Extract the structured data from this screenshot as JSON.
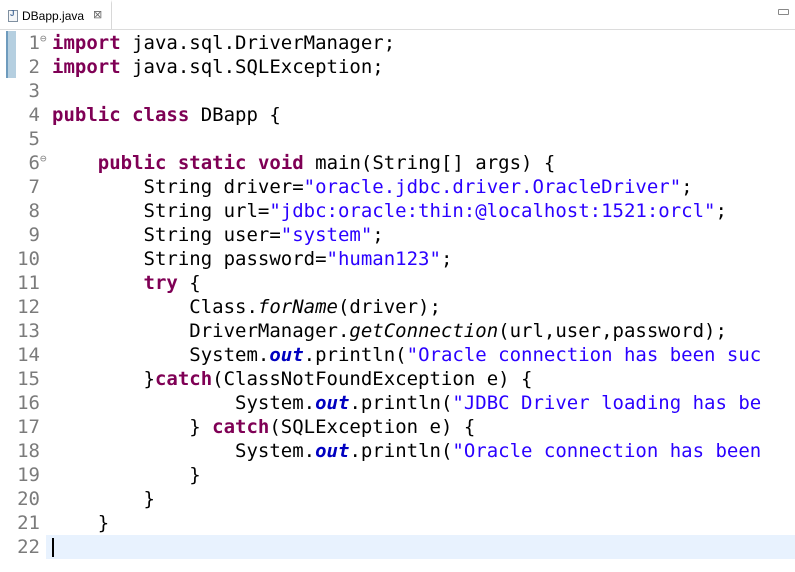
{
  "tab": {
    "title": "DBapp.java",
    "close_glyph": "⊠"
  },
  "editor": {
    "lines": [
      {
        "n": "1",
        "fold": "⊖",
        "tokens": [
          {
            "t": "import",
            "c": "kw"
          },
          {
            "t": " java.sql.DriverManager;",
            "c": ""
          }
        ]
      },
      {
        "n": "2",
        "tokens": [
          {
            "t": "import",
            "c": "kw"
          },
          {
            "t": " java.sql.SQLException;",
            "c": ""
          }
        ]
      },
      {
        "n": "3",
        "tokens": []
      },
      {
        "n": "4",
        "tokens": [
          {
            "t": "public",
            "c": "kw"
          },
          {
            "t": " ",
            "c": ""
          },
          {
            "t": "class",
            "c": "kw"
          },
          {
            "t": " DBapp {",
            "c": ""
          }
        ]
      },
      {
        "n": "5",
        "tokens": []
      },
      {
        "n": "6",
        "fold": "⊖",
        "tokens": [
          {
            "t": "    ",
            "c": ""
          },
          {
            "t": "public",
            "c": "kw"
          },
          {
            "t": " ",
            "c": ""
          },
          {
            "t": "static",
            "c": "kw"
          },
          {
            "t": " ",
            "c": ""
          },
          {
            "t": "void",
            "c": "kw"
          },
          {
            "t": " main(String[] args) {",
            "c": ""
          }
        ]
      },
      {
        "n": "7",
        "tokens": [
          {
            "t": "        String driver=",
            "c": ""
          },
          {
            "t": "\"oracle.jdbc.driver.OracleDriver\"",
            "c": "str"
          },
          {
            "t": ";",
            "c": ""
          }
        ]
      },
      {
        "n": "8",
        "tokens": [
          {
            "t": "        String url=",
            "c": ""
          },
          {
            "t": "\"jdbc:oracle:thin:@localhost:1521:orcl\"",
            "c": "str"
          },
          {
            "t": ";",
            "c": ""
          }
        ]
      },
      {
        "n": "9",
        "tokens": [
          {
            "t": "        String user=",
            "c": ""
          },
          {
            "t": "\"system\"",
            "c": "str"
          },
          {
            "t": ";",
            "c": ""
          }
        ]
      },
      {
        "n": "10",
        "tokens": [
          {
            "t": "        String password=",
            "c": ""
          },
          {
            "t": "\"human123\"",
            "c": "str"
          },
          {
            "t": ";",
            "c": ""
          }
        ]
      },
      {
        "n": "11",
        "tokens": [
          {
            "t": "        ",
            "c": ""
          },
          {
            "t": "try",
            "c": "kw"
          },
          {
            "t": " {",
            "c": ""
          }
        ]
      },
      {
        "n": "12",
        "tokens": [
          {
            "t": "            Class.",
            "c": ""
          },
          {
            "t": "forName",
            "c": "ital"
          },
          {
            "t": "(driver);",
            "c": ""
          }
        ]
      },
      {
        "n": "13",
        "tokens": [
          {
            "t": "            DriverManager.",
            "c": ""
          },
          {
            "t": "getConnection",
            "c": "ital"
          },
          {
            "t": "(url,user,password);",
            "c": ""
          }
        ]
      },
      {
        "n": "14",
        "tokens": [
          {
            "t": "            System.",
            "c": ""
          },
          {
            "t": "out",
            "c": "fld"
          },
          {
            "t": ".println(",
            "c": ""
          },
          {
            "t": "\"Oracle connection has been suc",
            "c": "str"
          }
        ]
      },
      {
        "n": "15",
        "tokens": [
          {
            "t": "        }",
            "c": ""
          },
          {
            "t": "catch",
            "c": "kw"
          },
          {
            "t": "(ClassNotFoundException e) {",
            "c": ""
          }
        ]
      },
      {
        "n": "16",
        "tokens": [
          {
            "t": "                System.",
            "c": ""
          },
          {
            "t": "out",
            "c": "fld"
          },
          {
            "t": ".println(",
            "c": ""
          },
          {
            "t": "\"JDBC Driver loading has be",
            "c": "str"
          }
        ]
      },
      {
        "n": "17",
        "tokens": [
          {
            "t": "            } ",
            "c": ""
          },
          {
            "t": "catch",
            "c": "kw"
          },
          {
            "t": "(SQLException e) {",
            "c": ""
          }
        ]
      },
      {
        "n": "18",
        "tokens": [
          {
            "t": "                System.",
            "c": ""
          },
          {
            "t": "out",
            "c": "fld"
          },
          {
            "t": ".println(",
            "c": ""
          },
          {
            "t": "\"Oracle connection has been",
            "c": "str"
          }
        ]
      },
      {
        "n": "19",
        "tokens": [
          {
            "t": "            }",
            "c": ""
          }
        ]
      },
      {
        "n": "20",
        "tokens": [
          {
            "t": "        }",
            "c": ""
          }
        ]
      },
      {
        "n": "21",
        "tokens": [
          {
            "t": "    }",
            "c": ""
          }
        ]
      },
      {
        "n": "22",
        "tokens": []
      }
    ]
  },
  "colors": {
    "keyword": "#7f0055",
    "string": "#2a00ff",
    "field": "#0000c0",
    "line_number": "#7b7b7b",
    "current_line": "#e8f2fe"
  }
}
